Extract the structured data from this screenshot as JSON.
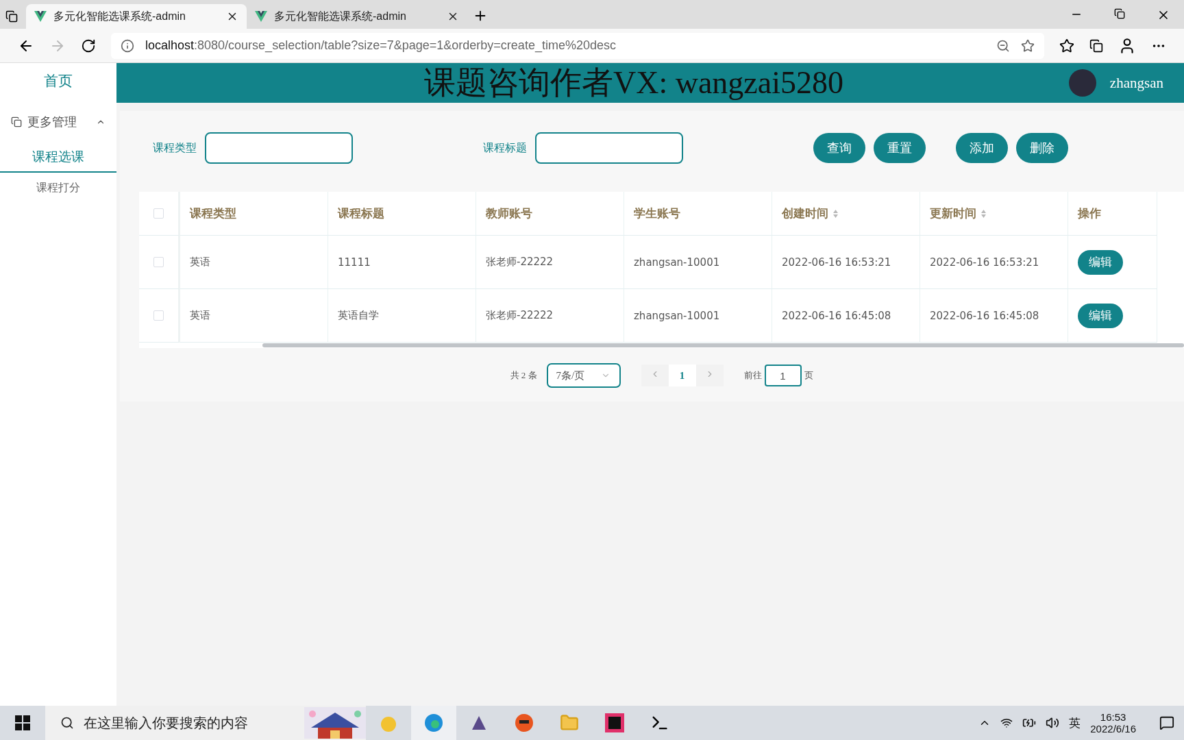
{
  "browser": {
    "tabs": [
      {
        "title": "多元化智能选课系统-admin",
        "selected": true
      },
      {
        "title": "多元化智能选课系统-admin",
        "selected": false
      }
    ],
    "url": {
      "host": "localhost",
      "rest": ":8080/course_selection/table?size=7&page=1&orderby=create_time%20desc"
    }
  },
  "sidebar": {
    "home": "首页",
    "group": {
      "label": "更多管理",
      "expanded": true,
      "children": [
        {
          "label": "课程选课",
          "selected": true
        },
        {
          "label": "课程打分",
          "selected": false
        }
      ]
    }
  },
  "header": {
    "title": "课题咨询作者VX: wangzai5280",
    "user": "zhangsan"
  },
  "filters": [
    {
      "label": "课程类型"
    },
    {
      "label": "课程标题"
    }
  ],
  "buttons": [
    {
      "label": "查询"
    },
    {
      "label": "重置"
    },
    {
      "label": "添加"
    },
    {
      "label": "删除"
    }
  ],
  "table": {
    "all_checked": false,
    "columns": [
      {
        "label": "课程类型",
        "sortable": false
      },
      {
        "label": "课程标题",
        "sortable": false
      },
      {
        "label": "教师账号",
        "sortable": false
      },
      {
        "label": "学生账号",
        "sortable": false
      },
      {
        "label": "创建时间",
        "sortable": true
      },
      {
        "label": "更新时间",
        "sortable": true
      },
      {
        "label": "操作",
        "sortable": false
      }
    ],
    "rows": [
      {
        "checked": false,
        "cells": [
          "英语",
          "11111",
          "张老师-22222",
          "zhangsan-10001",
          "2022-06-16 16:53:21",
          "2022-06-16 16:53:21"
        ],
        "action": "编辑"
      },
      {
        "checked": false,
        "cells": [
          "英语",
          "英语自学",
          "张老师-22222",
          "zhangsan-10001",
          "2022-06-16 16:45:08",
          "2022-06-16 16:45:08"
        ],
        "action": "编辑"
      }
    ]
  },
  "pagination": {
    "total": "共 2 条",
    "page_size": "7条/页",
    "pages": [
      {
        "label": "1",
        "selected": true
      }
    ],
    "goto_label": "前往",
    "goto_value": "1",
    "goto_suffix": "页"
  },
  "taskbar": {
    "search_placeholder": "在这里输入你要搜索的内容",
    "ime": "英",
    "time": "16:53",
    "date": "2022/6/16"
  }
}
